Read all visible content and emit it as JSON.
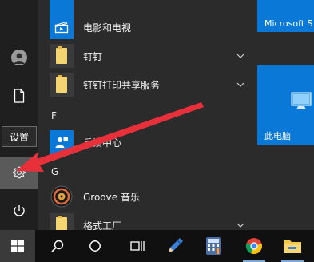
{
  "rail": {
    "settings_tooltip": "设置",
    "account_icon": "person-icon",
    "documents_icon": "document-icon",
    "settings_icon": "gear-icon",
    "power_icon": "power-icon"
  },
  "app_list": {
    "items": [
      {
        "name": "",
        "icon": "app-tile-icon",
        "expandable": false
      },
      {
        "name": "电影和电视",
        "icon": "film-icon",
        "expandable": false
      },
      {
        "name": "钉钉",
        "icon": "folder-icon",
        "expandable": true
      },
      {
        "name": "钉钉打印共享服务",
        "icon": "folder-icon",
        "expandable": true
      },
      {
        "name": "反馈中心",
        "icon": "feedback-person-icon",
        "expandable": false
      },
      {
        "name": "Groove 音乐",
        "icon": "music-disc-icon",
        "expandable": false
      },
      {
        "name": "格式工厂",
        "icon": "folder-icon",
        "expandable": true
      }
    ],
    "letters": [
      "F",
      "G"
    ]
  },
  "tiles": {
    "microsoft_store_label": "Microsoft S",
    "this_pc_label": "此电脑"
  },
  "taskbar": {
    "icons": [
      "windows-logo-icon",
      "search-icon",
      "task-view-icon",
      "timeline-icon",
      "pen-app-icon",
      "calculator-icon",
      "chrome-icon",
      "file-explorer-icon"
    ]
  },
  "annotation": {
    "arrow_color": "#e8303a"
  },
  "colors": {
    "tile_blue": "#0a78d7",
    "folder_yellow": "#f4d571"
  }
}
